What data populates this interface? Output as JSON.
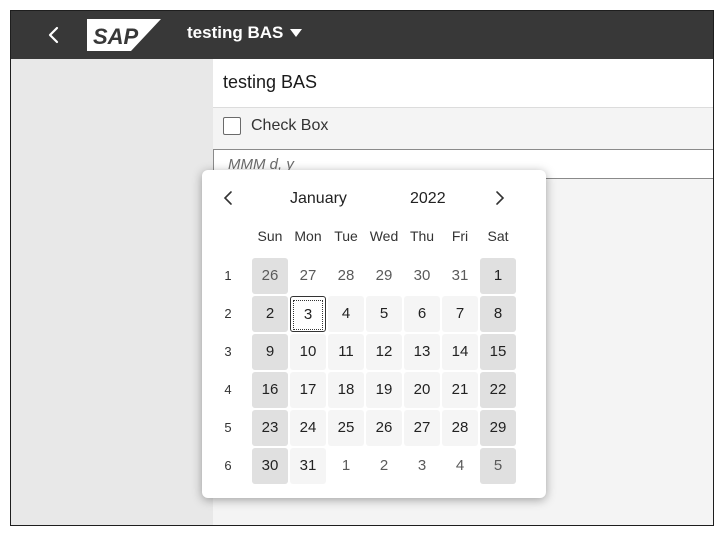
{
  "shell": {
    "logo_text": "SAP",
    "app_title": "testing BAS"
  },
  "form": {
    "title": "testing BAS",
    "checkbox_label": "Check Box",
    "date_placeholder": "MMM d, y"
  },
  "calendar": {
    "month": "January",
    "year": "2022",
    "weekdays": [
      "Sun",
      "Mon",
      "Tue",
      "Wed",
      "Thu",
      "Fri",
      "Sat"
    ],
    "weeks": [
      {
        "number": "1",
        "days": [
          {
            "label": "26",
            "outside": true
          },
          {
            "label": "27",
            "outside": true
          },
          {
            "label": "28",
            "outside": true
          },
          {
            "label": "29",
            "outside": true
          },
          {
            "label": "30",
            "outside": true
          },
          {
            "label": "31",
            "outside": true
          },
          {
            "label": "1",
            "outside": false
          }
        ]
      },
      {
        "number": "2",
        "days": [
          {
            "label": "2",
            "outside": false
          },
          {
            "label": "3",
            "outside": false,
            "today": true
          },
          {
            "label": "4",
            "outside": false
          },
          {
            "label": "5",
            "outside": false
          },
          {
            "label": "6",
            "outside": false
          },
          {
            "label": "7",
            "outside": false
          },
          {
            "label": "8",
            "outside": false
          }
        ]
      },
      {
        "number": "3",
        "days": [
          {
            "label": "9",
            "outside": false
          },
          {
            "label": "10",
            "outside": false
          },
          {
            "label": "11",
            "outside": false
          },
          {
            "label": "12",
            "outside": false
          },
          {
            "label": "13",
            "outside": false
          },
          {
            "label": "14",
            "outside": false
          },
          {
            "label": "15",
            "outside": false
          }
        ]
      },
      {
        "number": "4",
        "days": [
          {
            "label": "16",
            "outside": false
          },
          {
            "label": "17",
            "outside": false
          },
          {
            "label": "18",
            "outside": false
          },
          {
            "label": "19",
            "outside": false
          },
          {
            "label": "20",
            "outside": false
          },
          {
            "label": "21",
            "outside": false
          },
          {
            "label": "22",
            "outside": false
          }
        ]
      },
      {
        "number": "5",
        "days": [
          {
            "label": "23",
            "outside": false
          },
          {
            "label": "24",
            "outside": false
          },
          {
            "label": "25",
            "outside": false
          },
          {
            "label": "26",
            "outside": false
          },
          {
            "label": "27",
            "outside": false
          },
          {
            "label": "28",
            "outside": false
          },
          {
            "label": "29",
            "outside": false
          }
        ]
      },
      {
        "number": "6",
        "days": [
          {
            "label": "30",
            "outside": false
          },
          {
            "label": "31",
            "outside": false
          },
          {
            "label": "1",
            "outside": true
          },
          {
            "label": "2",
            "outside": true
          },
          {
            "label": "3",
            "outside": true
          },
          {
            "label": "4",
            "outside": true
          },
          {
            "label": "5",
            "outside": true
          }
        ]
      }
    ]
  },
  "colors": {
    "shellbar": "#383838",
    "weekend_cell": "#e0e0e0",
    "weekday_cell": "#f5f5f5"
  }
}
